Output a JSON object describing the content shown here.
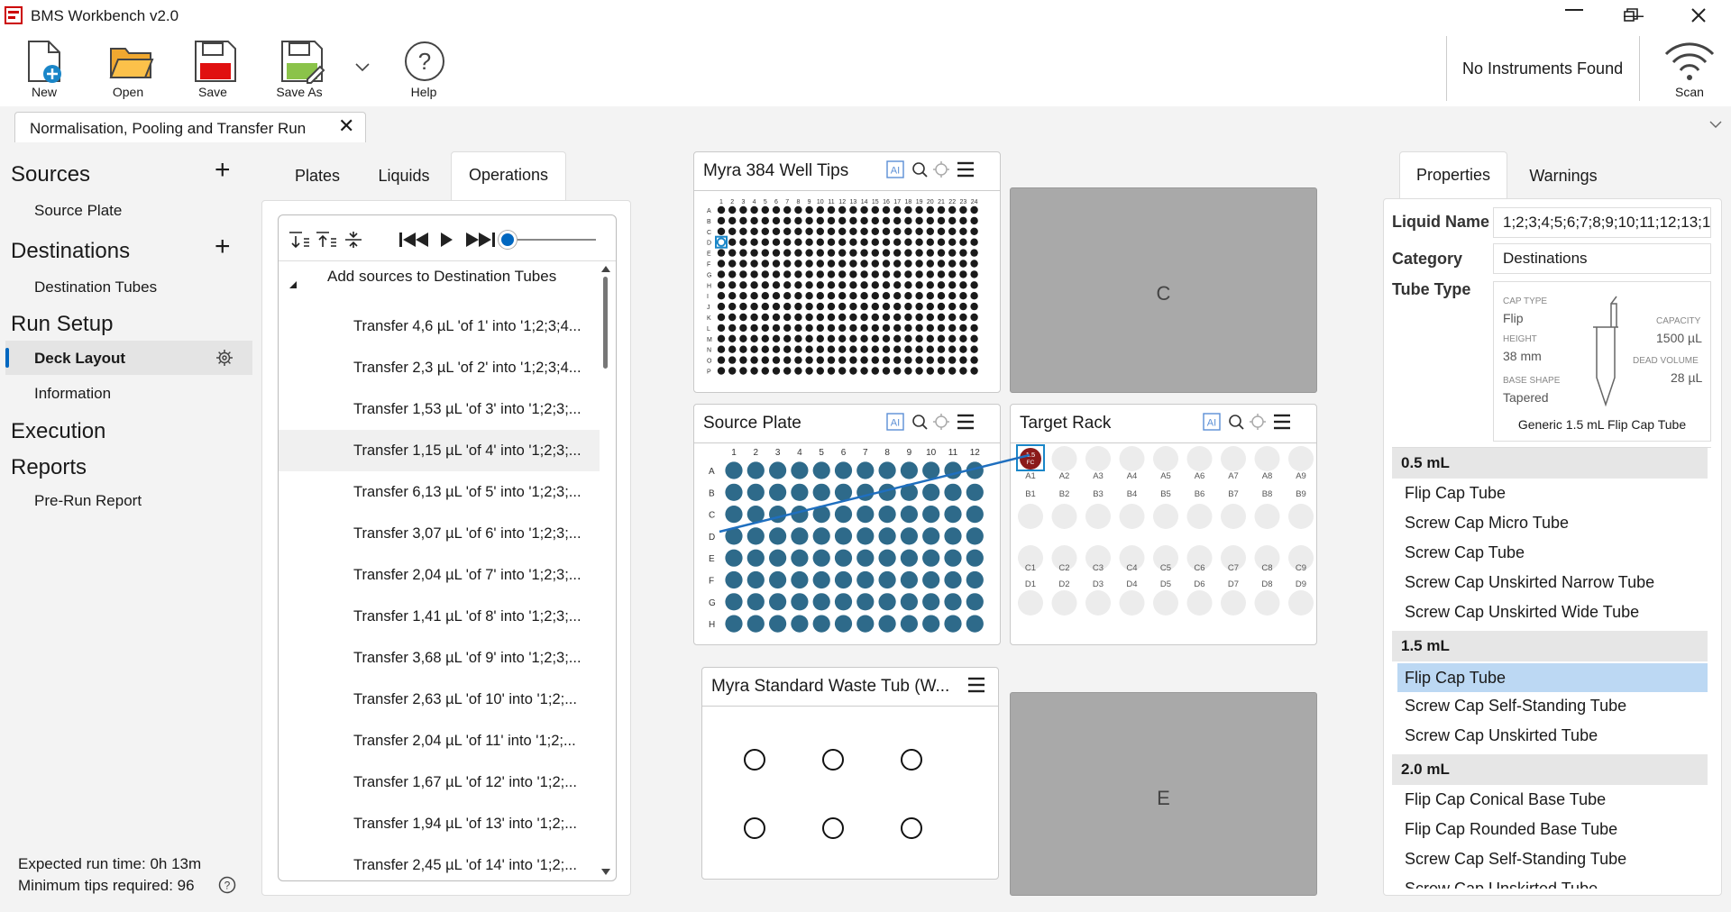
{
  "app": {
    "title": "BMS Workbench v2.0"
  },
  "toolbar": {
    "new": "New",
    "open": "Open",
    "save": "Save",
    "save_as": "Save As",
    "help": "Help",
    "instruments": "No Instruments Found",
    "scan": "Scan"
  },
  "doc_tab": {
    "label": "Normalisation, Pooling and Transfer Run"
  },
  "sidebar": {
    "sources": "Sources",
    "source_plate": "Source Plate",
    "destinations": "Destinations",
    "destination_tubes": "Destination Tubes",
    "run_setup": "Run Setup",
    "deck_layout": "Deck Layout",
    "information": "Information",
    "execution": "Execution",
    "reports": "Reports",
    "pre_run_report": "Pre-Run Report",
    "expected_time": "Expected run time: 0h 13m",
    "min_tips": "Minimum tips required: 96"
  },
  "center_tabs": [
    "Plates",
    "Liquids",
    "Operations"
  ],
  "operations": {
    "group": "Add sources to Destination Tubes",
    "items": [
      "Transfer 4,6 µL 'of 1' into '1;2;3;4...",
      "Transfer 2,3 µL 'of 2' into '1;2;3;4...",
      "Transfer 1,53 µL 'of 3' into '1;2;3;...",
      "Transfer 1,15 µL 'of 4' into '1;2;3;...",
      "Transfer 6,13 µL 'of 5' into '1;2;3;...",
      "Transfer 3,07 µL 'of 6' into '1;2;3;...",
      "Transfer 2,04 µL 'of 7' into '1;2;3;...",
      "Transfer 1,41 µL 'of 8' into '1;2;3;...",
      "Transfer 3,68 µL 'of 9' into '1;2;3;...",
      "Transfer 2,63 µL 'of 10' into '1;2;...",
      "Transfer 2,04 µL 'of 11' into '1;2;...",
      "Transfer 1,67 µL 'of 12' into '1;2;...",
      "Transfer 1,94 µL 'of 13' into '1;2;...",
      "Transfer 2,45 µL 'of 14' into '1;2;..."
    ]
  },
  "deck": {
    "tips": {
      "title": "Myra 384 Well Tips",
      "rows": [
        "A",
        "B",
        "C",
        "D",
        "E",
        "F",
        "G",
        "H",
        "I",
        "J",
        "K",
        "L",
        "M",
        "N",
        "O",
        "P"
      ],
      "cols": 24
    },
    "slot_c": "C",
    "slot_e": "E",
    "source_plate": {
      "title": "Source Plate",
      "rows": [
        "A",
        "B",
        "C",
        "D",
        "E",
        "F",
        "G",
        "H"
      ],
      "cols": [
        "1",
        "2",
        "3",
        "4",
        "5",
        "6",
        "7",
        "8",
        "9",
        "10",
        "11",
        "12"
      ]
    },
    "target_rack": {
      "title": "Target Rack",
      "rows": [
        "A",
        "B",
        "C",
        "D"
      ],
      "cols": [
        "1",
        "2",
        "3",
        "4",
        "5",
        "6",
        "7",
        "8",
        "9"
      ],
      "badge_top": "1.5",
      "badge_bot": "FC"
    },
    "waste": {
      "title": "Myra Standard Waste Tub (W..."
    }
  },
  "properties": {
    "tabs": [
      "Properties",
      "Warnings"
    ],
    "liquid_name_label": "Liquid Name",
    "liquid_name": "1;2;3;4;5;6;7;8;9;10;11;12;13;1",
    "category_label": "Category",
    "category": "Destinations",
    "tube_type_label": "Tube Type",
    "cap_type_label": "CAP TYPE",
    "cap_type": "Flip",
    "height_label": "HEIGHT",
    "height": "38 mm",
    "base_label": "BASE SHAPE",
    "base": "Tapered",
    "capacity_label": "CAPACITY",
    "capacity": "1500 µL",
    "dead_label": "DEAD VOLUME",
    "dead": "28 µL",
    "tube_name": "Generic 1.5 mL Flip Cap Tube",
    "groups": [
      {
        "name": "0.5 mL",
        "items": [
          "Flip Cap Tube",
          "Screw Cap Micro Tube",
          "Screw Cap Tube",
          "Screw Cap Unskirted Narrow Tube",
          "Screw Cap Unskirted Wide Tube"
        ]
      },
      {
        "name": "1.5 mL",
        "items": [
          "Flip Cap Tube",
          "Screw Cap Self-Standing Tube",
          "Screw Cap Unskirted Tube"
        ]
      },
      {
        "name": "2.0 mL",
        "items": [
          "Flip Cap Conical Base Tube",
          "Flip Cap Rounded Base Tube",
          "Screw Cap Self-Standing Tube",
          "Screw Cap Unskirted Tube"
        ]
      }
    ]
  },
  "colors": {
    "well": "#2e6a8a",
    "accent": "#0067c0",
    "badge": "#8b1a1a"
  }
}
